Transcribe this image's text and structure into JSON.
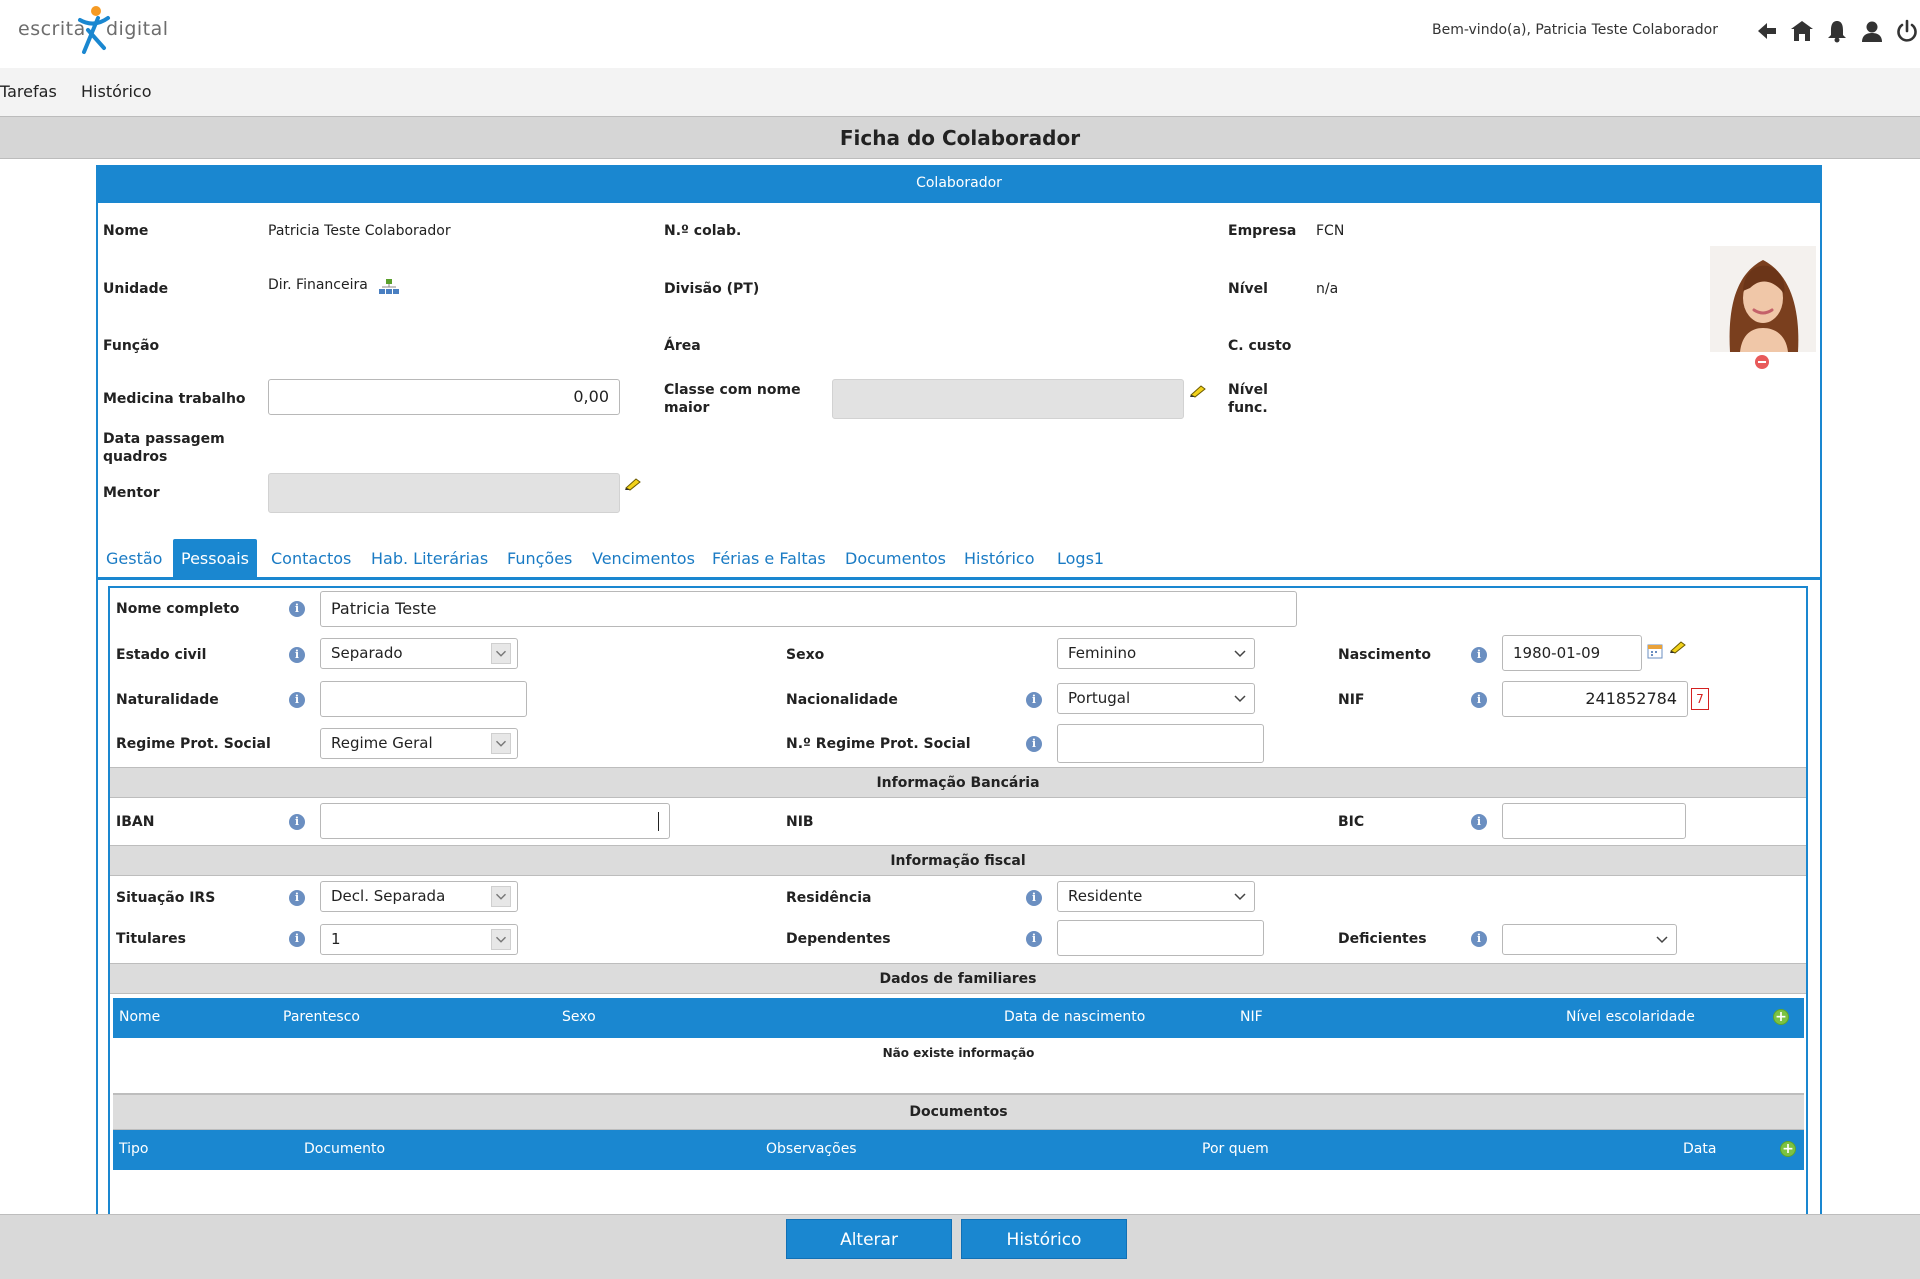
{
  "header": {
    "logo_left": "escrita",
    "logo_right": "digital",
    "welcome": "Bem-vindo(a), Patricia Teste Colaborador",
    "icons": [
      "arrow-left-icon",
      "home-icon",
      "bell-icon",
      "user-icon",
      "power-icon"
    ]
  },
  "topnav": {
    "item1": "Tarefas",
    "item2": "Histórico"
  },
  "title": "Ficha do Colaborador",
  "panel_title": "Colaborador",
  "fields": {
    "nome_label": "Nome",
    "nome_value": "Patricia Teste Colaborador",
    "ncolab_label": "N.º colab.",
    "empresa_label": "Empresa",
    "empresa_value": "FCN",
    "unidade_label": "Unidade",
    "unidade_value": "Dir. Financeira",
    "divisao_label": "Divisão (PT)",
    "nivel_label": "Nível",
    "nivel_value": "n/a",
    "funcao_label": "Função",
    "area_label": "Área",
    "ccusto_label": "C. custo",
    "medicina_label": "Medicina trabalho",
    "medicina_value": "0,00",
    "classe_label_1": "Classe com nome",
    "classe_label_2": "maior",
    "nivelfunc_label_1": "Nível",
    "nivelfunc_label_2": "func.",
    "datapass_label_1": "Data passagem",
    "datapass_label_2": "quadros",
    "mentor_label": "Mentor"
  },
  "tabs": [
    "Gestão",
    "Pessoais",
    "Contactos",
    "Hab. Literárias",
    "Funções",
    "Vencimentos",
    "Férias e Faltas",
    "Documentos",
    "Histórico",
    "Logs1"
  ],
  "active_tab": "Pessoais",
  "pessoais": {
    "nome_completo_label": "Nome completo",
    "nome_completo_value": "Patricia Teste",
    "estado_civil_label": "Estado civil",
    "estado_civil_value": "Separado",
    "sexo_label": "Sexo",
    "sexo_value": "Feminino",
    "nascimento_label": "Nascimento",
    "nascimento_value": "1980-01-09",
    "naturalidade_label": "Naturalidade",
    "nacionalidade_label": "Nacionalidade",
    "nacionalidade_value": "Portugal",
    "nif_label": "NIF",
    "nif_value": "241852784",
    "nif_badge": "7",
    "regime_label": "Regime Prot. Social",
    "regime_value": "Regime Geral",
    "nregime_label": "N.º Regime Prot. Social"
  },
  "bancaria": {
    "title": "Informação Bancária",
    "iban_label": "IBAN",
    "nib_label": "NIB",
    "bic_label": "BIC"
  },
  "fiscal": {
    "title": "Informação fiscal",
    "irs_label": "Situação IRS",
    "irs_value": "Decl. Separada",
    "residencia_label": "Residência",
    "residencia_value": "Residente",
    "titulares_label": "Titulares",
    "titulares_value": "1",
    "dependentes_label": "Dependentes",
    "deficientes_label": "Deficientes"
  },
  "familiares": {
    "title": "Dados de familiares",
    "columns": [
      "Nome",
      "Parentesco",
      "Sexo",
      "Data de nascimento",
      "NIF",
      "Nível escolaridade"
    ],
    "empty": "Não existe informação"
  },
  "documentos": {
    "title": "Documentos",
    "columns": [
      "Tipo",
      "Documento",
      "Observações",
      "Por quem",
      "Data"
    ]
  },
  "buttons": {
    "alterar": "Alterar",
    "historico": "Histórico"
  },
  "colors": {
    "accent": "#1a87d0",
    "section_grey": "#dcdcdc",
    "add_green": "#7cc242",
    "info_blue": "#6b8fc1"
  }
}
